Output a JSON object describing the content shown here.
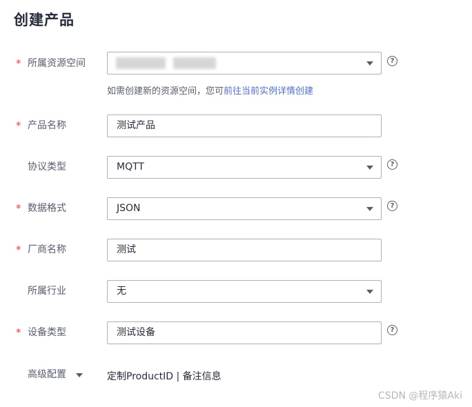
{
  "page": {
    "title": "创建产品"
  },
  "form": {
    "space": {
      "label": "所属资源空间",
      "required": true,
      "value": "",
      "hint_prefix": "如需创建新的资源空间，您可",
      "hint_link": "前往当前实例详情创建"
    },
    "product_name": {
      "label": "产品名称",
      "required": true,
      "value": "测试产品"
    },
    "protocol": {
      "label": "协议类型",
      "required": false,
      "value": "MQTT"
    },
    "data_format": {
      "label": "数据格式",
      "required": true,
      "value": "JSON"
    },
    "vendor": {
      "label": "厂商名称",
      "required": true,
      "value": "测试"
    },
    "industry": {
      "label": "所属行业",
      "required": false,
      "value": "无"
    },
    "device_type": {
      "label": "设备类型",
      "required": true,
      "value": "测试设备"
    },
    "advanced": {
      "label": "高级配置",
      "links": "定制ProductID | 备注信息"
    }
  },
  "required_mark": "*",
  "help_glyph": "?",
  "watermark": "CSDN @程序猿Aki",
  "colors": {
    "required": "#e54545",
    "link": "#526ecc",
    "border": "#adb0b8"
  },
  "icons": {
    "help": "question-circle-icon",
    "dropdown": "caret-down-icon"
  }
}
